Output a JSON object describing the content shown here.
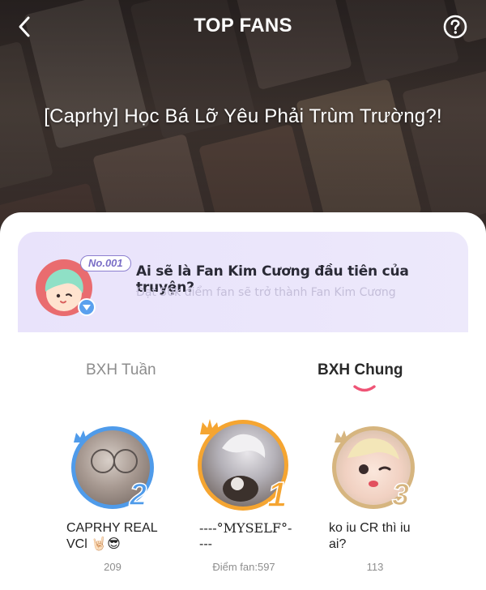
{
  "header": {
    "title": "TOP FANS",
    "back_icon": "chevron-left-icon",
    "help_icon": "question-circle-icon"
  },
  "story": {
    "title": "[Caprhy] Học Bá Lỡ Yêu Phải Trùm Trường?!"
  },
  "banner": {
    "rank_tag": "No.001",
    "question": "Ai sẽ là Fan Kim Cương đầu tiên của truyện?",
    "subtitle": "Đạt 50k điểm fan sẽ trở thành Fan Kim Cương"
  },
  "tabs": [
    {
      "label": "BXH Tuần",
      "active": false
    },
    {
      "label": "BXH Chung",
      "active": true
    }
  ],
  "podium": [
    {
      "rank": "2",
      "name_line1": "CAPRHY REAL",
      "name_line2": "VCl 🤘🏻😎",
      "score": "209"
    },
    {
      "rank": "1",
      "name_line1": "----°MYSELF°-",
      "name_line2": "---",
      "score": "Điểm fan:597"
    },
    {
      "rank": "3",
      "name_line1": "ko iu CR thì iu",
      "name_line2": "ai?",
      "score": "113"
    }
  ],
  "colors": {
    "rank1": "#f5a531",
    "rank2": "#4f9bea",
    "rank3": "#d6b57f",
    "banner_bg": "#e9e3fb",
    "tab_indicator": "#ef5476"
  }
}
